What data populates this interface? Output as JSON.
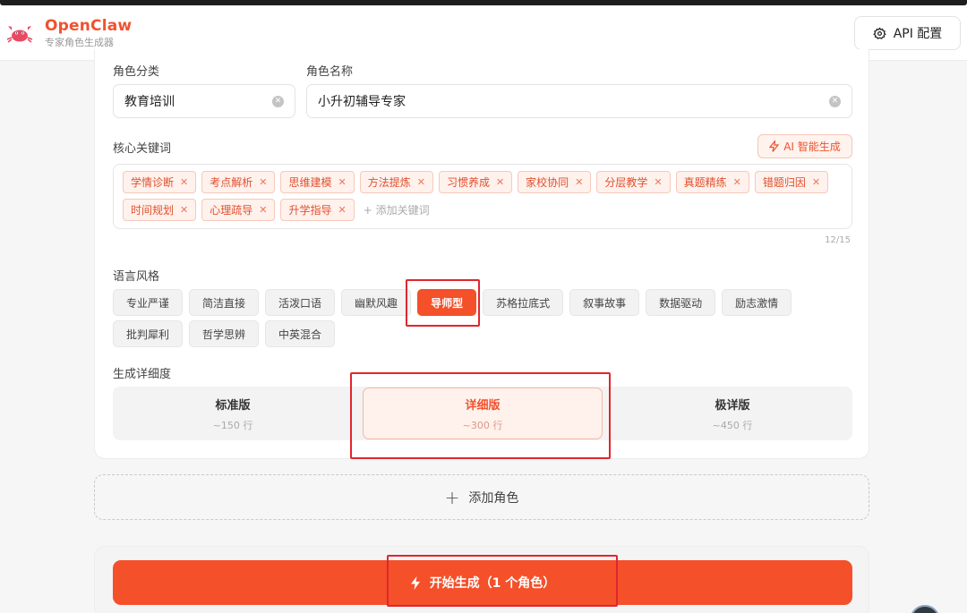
{
  "app": {
    "name": "OpenClaw",
    "subtitle": "专家角色生成器",
    "api_button": "API 配置"
  },
  "form": {
    "category_label": "角色分类",
    "category_value": "教育培训",
    "name_label": "角色名称",
    "name_value": "小升初辅导专家",
    "keywords_label": "核心关键词",
    "ai_generate_label": "AI 智能生成",
    "keywords": [
      "学情诊断",
      "考点解析",
      "思维建模",
      "方法提炼",
      "习惯养成",
      "家校协同",
      "分层教学",
      "真题精练",
      "错题归因",
      "时间规划",
      "心理疏导",
      "升学指导"
    ],
    "keywords_placeholder": "+ 添加关键词",
    "keywords_count": "12/15",
    "style_label": "语言风格",
    "styles": [
      "专业严谨",
      "简洁直接",
      "活泼口语",
      "幽默风趣",
      "导师型",
      "苏格拉底式",
      "叙事故事",
      "数据驱动",
      "励志激情",
      "批判犀利",
      "哲学思辨",
      "中英混合"
    ],
    "selected_style": "导师型",
    "detail_label": "生成详细度",
    "detail_options": [
      {
        "title": "标准版",
        "sub": "~150 行"
      },
      {
        "title": "详细版",
        "sub": "~300 行"
      },
      {
        "title": "极详版",
        "sub": "~450 行"
      }
    ],
    "selected_detail": "详细版"
  },
  "add_role_label": "添加角色",
  "start_button": "开始生成（1 个角色）",
  "colors": {
    "accent": "#f4502a",
    "highlight": "#e0262c"
  }
}
